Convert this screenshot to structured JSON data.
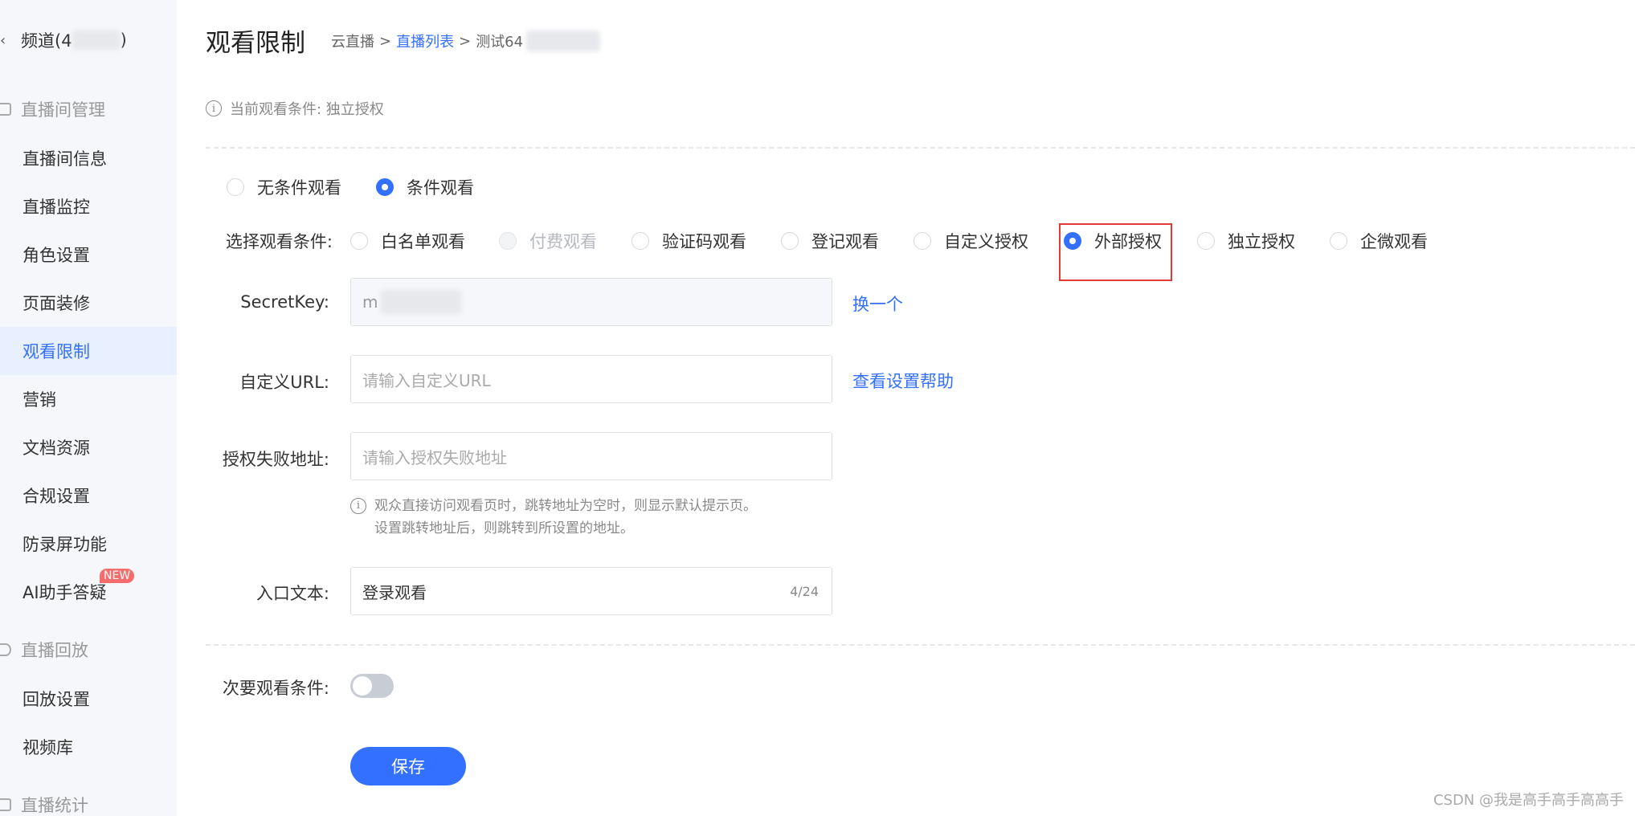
{
  "sidebar": {
    "channel_label": "频道(4",
    "channel_suffix": ")",
    "groups": {
      "live_room": "直播间管理",
      "playback": "直播回放",
      "stats": "直播统计"
    },
    "items": [
      {
        "label": "直播间信息"
      },
      {
        "label": "直播监控"
      },
      {
        "label": "角色设置"
      },
      {
        "label": "页面装修"
      },
      {
        "label": "观看限制"
      },
      {
        "label": "营销"
      },
      {
        "label": "文档资源"
      },
      {
        "label": "合规设置"
      },
      {
        "label": "防录屏功能"
      },
      {
        "label": "AI助手答疑"
      }
    ],
    "new_badge": "NEW",
    "playback_items": [
      {
        "label": "回放设置"
      },
      {
        "label": "视频库"
      }
    ]
  },
  "header": {
    "title": "观看限制",
    "breadcrumb": {
      "root": "云直播",
      "list": "直播列表",
      "current": "测试64",
      "sep": ">"
    }
  },
  "info": {
    "icon": "i",
    "text": "当前观看条件: 独立授权"
  },
  "mode": {
    "options": [
      "无条件观看",
      "条件观看"
    ],
    "selected": "条件观看"
  },
  "conditions": {
    "label": "选择观看条件:",
    "options": [
      "白名单观看",
      "付费观看",
      "验证码观看",
      "登记观看",
      "自定义授权",
      "外部授权",
      "独立授权",
      "企微观看"
    ],
    "selected": "外部授权",
    "disabled": "付费观看"
  },
  "secret": {
    "label": "SecretKey:",
    "value": "m",
    "action": "换一个"
  },
  "custom_url": {
    "label": "自定义URL:",
    "placeholder": "请输入自定义URL",
    "help": "查看设置帮助"
  },
  "fail_url": {
    "label": "授权失败地址:",
    "placeholder": "请输入授权失败地址",
    "hint_line1": "观众直接访问观看页时，跳转地址为空时，则显示默认提示页。",
    "hint_line2": "设置跳转地址后，则跳转到所设置的地址。"
  },
  "entry_text": {
    "label": "入口文本:",
    "value": "登录观看",
    "counter": "4/24"
  },
  "secondary": {
    "label": "次要观看条件:",
    "enabled": false
  },
  "save_label": "保存",
  "watermark": "CSDN @我是高手高手高高手",
  "colors": {
    "accent": "#3370ff",
    "highlight": "#e53935",
    "badge": "#f56c6c"
  }
}
